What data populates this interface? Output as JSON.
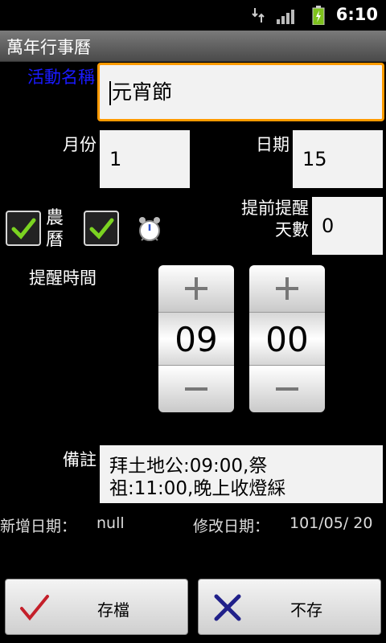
{
  "status_bar": {
    "network": "3G",
    "time": "6:10"
  },
  "title_bar": {
    "title": "萬年行事曆"
  },
  "form": {
    "event_name_label": "活動名稱",
    "event_name_value": "元宵節",
    "month_label": "月份",
    "month_value": "1",
    "day_label": "日期",
    "day_value": "15",
    "lunar_label_1": "農",
    "lunar_label_2": "曆",
    "lunar_checked": true,
    "alarm_checked": true,
    "advance_label_1": "提前提醒",
    "advance_label_2": "天數",
    "advance_value": "0",
    "remind_time_label": "提醒時間",
    "hour_value": "09",
    "minute_value": "00",
    "note_label": "備註",
    "note_line_1": "拜土地公:09:00,祭",
    "note_line_2": "祖:11:00,晚上收燈綵",
    "created_label": "新增日期：",
    "created_value": "null",
    "modified_label": "修改日期：",
    "modified_value": "101/05/ 20"
  },
  "buttons": {
    "save_label": "存檔",
    "discard_label": "不存"
  },
  "colors": {
    "accent_label": "#1a1aff",
    "focus_border": "#ff9a00",
    "check_green": "#7bd321"
  }
}
